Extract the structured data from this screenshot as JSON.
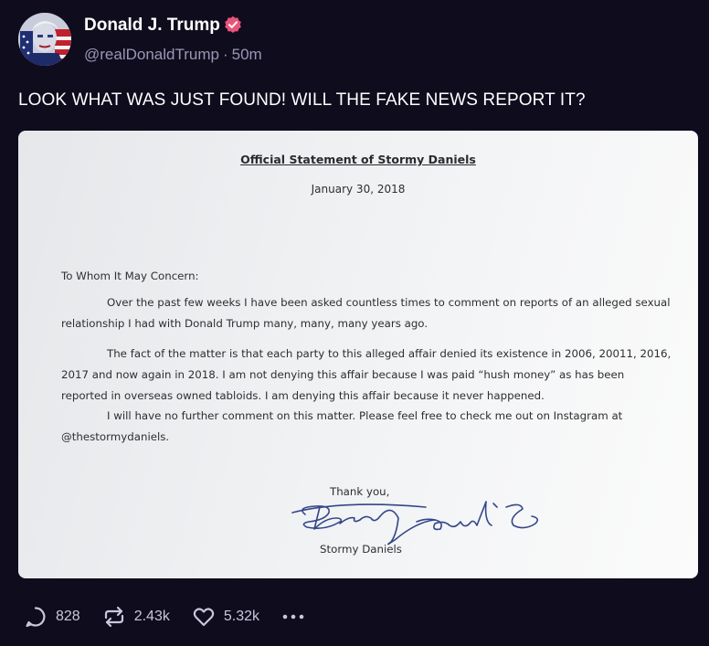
{
  "post": {
    "author": {
      "display_name": "Donald J. Trump",
      "handle": "@realDonaldTrump",
      "separator": "·",
      "time_ago": "50m",
      "verified": true
    },
    "text": "LOOK WHAT WAS JUST FOUND! WILL THE FAKE NEWS REPORT IT?",
    "media": {
      "title": "Official Statement of Stormy Daniels",
      "date": "January 30, 2018",
      "greeting": "To Whom It May Concern:",
      "paragraphs": [
        "Over the past few weeks I have been asked countless times to comment on reports of an alleged sexual relationship I had with Donald Trump many, many, many years ago.",
        "The fact of the matter is that each party to this alleged affair denied its existence in 2006, 20011, 2016, 2017 and now again in 2018. I am not denying this affair because I was paid “hush money” as has been reported in overseas owned tabloids. I am denying this affair because it never happened.",
        "I will have no further comment on this matter. Please feel free to check me out on Instagram at @thestormydaniels."
      ],
      "sign_off": "Thank you,",
      "signer": "Stormy Daniels"
    },
    "actions": {
      "replies": "828",
      "reposts": "2.43k",
      "likes": "5.32k"
    }
  },
  "colors": {
    "background": "#0f0c1d",
    "muted_text": "#9a97b5",
    "verified_badge": "#e9547a",
    "signature_ink": "#34468a"
  },
  "icons": [
    "verified-badge-icon",
    "reply-icon",
    "repost-icon",
    "like-icon",
    "more-icon"
  ]
}
